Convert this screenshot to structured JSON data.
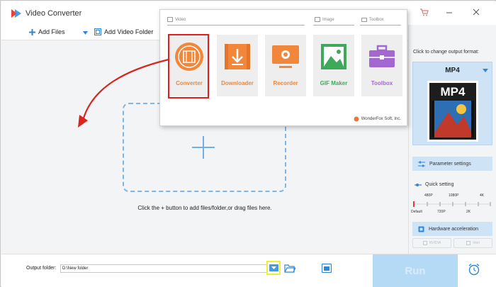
{
  "window": {
    "title": "Video Converter"
  },
  "toolbar": {
    "add_files": "Add Files",
    "add_video_folder": "Add Video Folder"
  },
  "workarea": {
    "hint": "Click the + button to add files/folder,or drag files here."
  },
  "popup": {
    "sections": {
      "video": "Video",
      "image": "Image",
      "toolbox": "Toolbox"
    },
    "tiles": [
      {
        "label": "Converter",
        "color": "#f0873a"
      },
      {
        "label": "Downloader",
        "color": "#f0873a"
      },
      {
        "label": "Recorder",
        "color": "#f0873a"
      },
      {
        "label": "GIF Maker",
        "color": "#3fa95a"
      },
      {
        "label": "Toolbox",
        "color": "#a368cf"
      }
    ],
    "brand": "WonderFox Soft, Inc."
  },
  "right_panel": {
    "change_format_label": "Click to change output format:",
    "format": "MP4",
    "format_icon_text": "MP4",
    "parameter_settings": "Parameter settings",
    "quick_setting": "Quick setting",
    "quality_ticks_top": [
      "480P",
      "1080P",
      "4K"
    ],
    "quality_ticks_bottom": [
      "Default",
      "720P",
      "2K"
    ],
    "hardware_acceleration": "Hardware acceleration",
    "gpu_options": [
      "NVIDIA",
      "Intel"
    ]
  },
  "bottom": {
    "output_folder_label": "Output folder:",
    "output_folder_value": "D:\\New folder",
    "run": "Run"
  },
  "colors": {
    "accent": "#4a98dd",
    "highlight_red": "#e01e1e",
    "highlight_yellow": "#f0ee33",
    "run_bg": "#b5daf6"
  }
}
